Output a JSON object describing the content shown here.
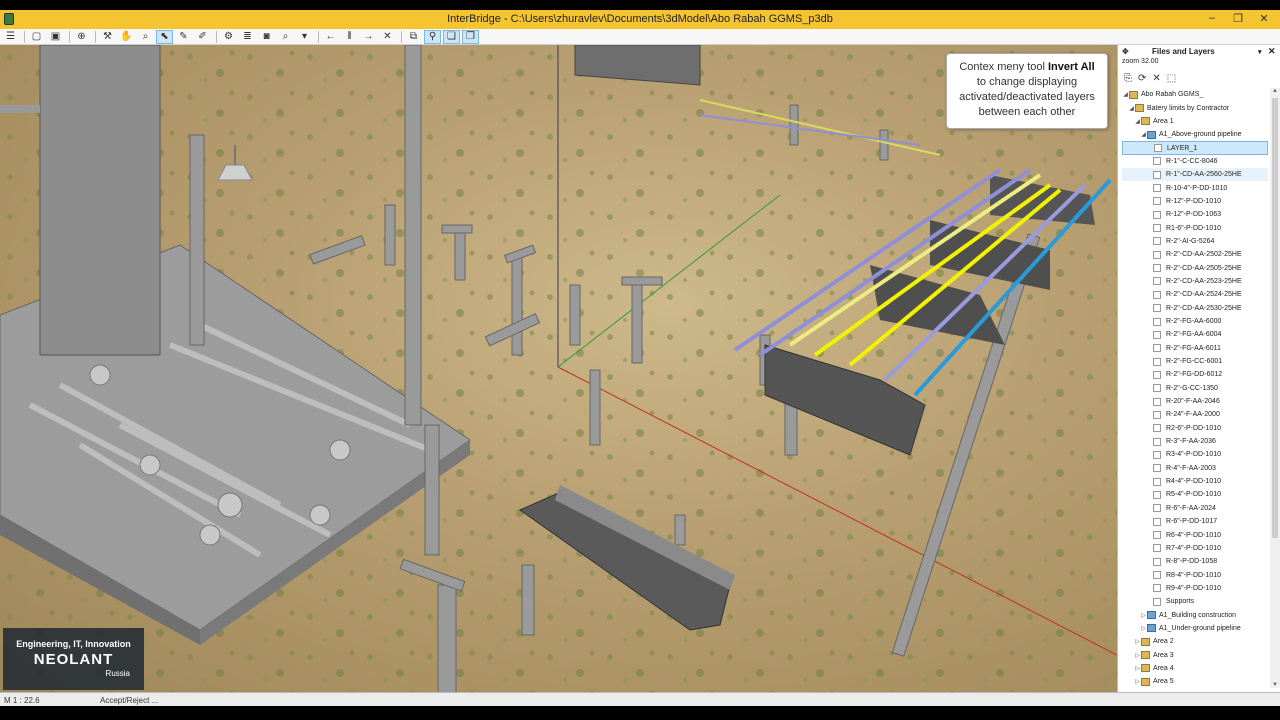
{
  "window": {
    "title": "InterBridge - C:\\Users\\zhuravlev\\Documents\\3dModel\\Abo Rabah GGMS_p3db",
    "buttons": [
      "–",
      "❐",
      "✕"
    ]
  },
  "toolbar": {
    "icons": [
      "menu-icon",
      "open-icon",
      "image-icon",
      "target-icon",
      "brush-icon",
      "pan-icon",
      "zoom-icon",
      "select-icon",
      "pencil-icon",
      "edit-icon",
      "settings-icon",
      "layers-icon",
      "camera-icon",
      "zoom-extent-icon",
      "arrow-left-icon",
      "split-icon",
      "arrow-right-icon",
      "close-icon",
      "frame-icon",
      "pin-icon",
      "copy-icon",
      "copy-alt-icon"
    ]
  },
  "callout": {
    "line1": "Contex meny tool ",
    "bold": "Invert All",
    "rest": "to change displaying activated/deactivated layers between each other"
  },
  "panel": {
    "title": "Files and Layers",
    "zoom": "zoom 32.00",
    "tree": [
      {
        "label": "Abo Rabah GGMS_",
        "level": 1,
        "caret": "◢",
        "kind": "folder"
      },
      {
        "label": "Batery limits by Contractor",
        "level": 2,
        "caret": "◢",
        "kind": "folder"
      },
      {
        "label": "Area 1",
        "level": 3,
        "caret": "◢",
        "kind": "folder"
      },
      {
        "label": "A1_Above-ground pipeline",
        "level": 4,
        "caret": "◢",
        "kind": "layer"
      },
      {
        "label": "LAYER_1",
        "level": 5,
        "kind": "chk",
        "state": "sel"
      },
      {
        "label": "R-1\"-C-CC-8046",
        "level": 5,
        "kind": "chk"
      },
      {
        "label": "R-1\"-CD-AA-2560-25HE",
        "level": 5,
        "kind": "chk",
        "state": "hov"
      },
      {
        "label": "R-10-4\"-P-DD-1010",
        "level": 5,
        "kind": "chk"
      },
      {
        "label": "R-12\"-P-DD-1010",
        "level": 5,
        "kind": "chk"
      },
      {
        "label": "R-12\"-P-DD-1063",
        "level": 5,
        "kind": "chk"
      },
      {
        "label": "R1-6\"-P-DD-1010",
        "level": 5,
        "kind": "chk"
      },
      {
        "label": "R-2\"-AI-G-5264",
        "level": 5,
        "kind": "chk"
      },
      {
        "label": "R-2\"-CD-AA-2502-25HE",
        "level": 5,
        "kind": "chk"
      },
      {
        "label": "R-2\"-CD-AA-2505-25HE",
        "level": 5,
        "kind": "chk"
      },
      {
        "label": "R-2\"-CD-AA-2523-25HE",
        "level": 5,
        "kind": "chk"
      },
      {
        "label": "R-2\"-CD-AA-2524-25HE",
        "level": 5,
        "kind": "chk"
      },
      {
        "label": "R-2\"-CD-AA-2530-25HE",
        "level": 5,
        "kind": "chk"
      },
      {
        "label": "R-2\"-FG-AA-6000",
        "level": 5,
        "kind": "chk"
      },
      {
        "label": "R-2\"-FG-AA-6004",
        "level": 5,
        "kind": "chk"
      },
      {
        "label": "R-2\"-FG-AA-6011",
        "level": 5,
        "kind": "chk"
      },
      {
        "label": "R-2\"-FG-CC-6001",
        "level": 5,
        "kind": "chk"
      },
      {
        "label": "R-2\"-FG-DD-6012",
        "level": 5,
        "kind": "chk"
      },
      {
        "label": "R-2\"-G-CC-1350",
        "level": 5,
        "kind": "chk"
      },
      {
        "label": "R-20\"-F-AA-2046",
        "level": 5,
        "kind": "chk"
      },
      {
        "label": "R-24\"-F-AA-2000",
        "level": 5,
        "kind": "chk"
      },
      {
        "label": "R2-6\"-P-DD-1010",
        "level": 5,
        "kind": "chk"
      },
      {
        "label": "R-3\"-F-AA-2036",
        "level": 5,
        "kind": "chk"
      },
      {
        "label": "R3-4\"-P-DD-1010",
        "level": 5,
        "kind": "chk"
      },
      {
        "label": "R-4\"-F-AA-2003",
        "level": 5,
        "kind": "chk"
      },
      {
        "label": "R4-4\"-P-DD-1010",
        "level": 5,
        "kind": "chk"
      },
      {
        "label": "R5-4\"-P-DD-1010",
        "level": 5,
        "kind": "chk"
      },
      {
        "label": "R-6\"-F-AA-2024",
        "level": 5,
        "kind": "chk"
      },
      {
        "label": "R-6\"-P-DD-1017",
        "level": 5,
        "kind": "chk"
      },
      {
        "label": "R6-4\"-P-DD-1010",
        "level": 5,
        "kind": "chk"
      },
      {
        "label": "R7-4\"-P-DD-1010",
        "level": 5,
        "kind": "chk"
      },
      {
        "label": "R-8\"-P-DD-1058",
        "level": 5,
        "kind": "chk"
      },
      {
        "label": "R8-4\"-P-DD-1010",
        "level": 5,
        "kind": "chk"
      },
      {
        "label": "R9-4\"-P-DD-1010",
        "level": 5,
        "kind": "chk"
      },
      {
        "label": "Supports",
        "level": 5,
        "kind": "chk"
      },
      {
        "label": "A1_Building construction",
        "level": 4,
        "caret": "▷",
        "kind": "layer"
      },
      {
        "label": "A1_Under-ground pipeline",
        "level": 4,
        "caret": "▷",
        "kind": "layer"
      },
      {
        "label": "Area 2",
        "level": 3,
        "caret": "▷",
        "kind": "folder"
      },
      {
        "label": "Area 3",
        "level": 3,
        "caret": "▷",
        "kind": "folder"
      },
      {
        "label": "Area 4",
        "level": 3,
        "caret": "▷",
        "kind": "folder"
      },
      {
        "label": "Area 5",
        "level": 3,
        "caret": "▷",
        "kind": "folder"
      }
    ]
  },
  "status": {
    "scale": "M 1 : 22.6",
    "message": "Accept/Reject ..."
  },
  "logo": {
    "tagline": "Engineering, IT, Innovation",
    "brand": "NEOLANT",
    "region": "Russia"
  }
}
